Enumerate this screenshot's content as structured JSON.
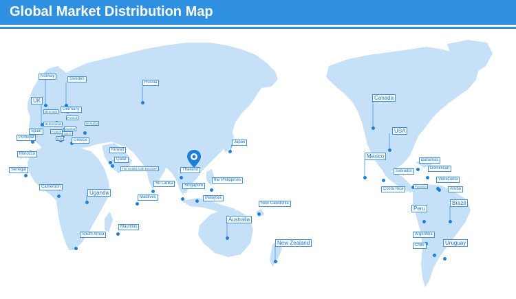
{
  "header": {
    "title": "Global Market Distribution Map"
  },
  "colors": {
    "accent": "#2f8fe0",
    "land": "#c6e0f7",
    "marker": "#1f7fd8",
    "label_border": "#3d93e3",
    "label_text": "#1a6fc0"
  },
  "icons": {
    "hq_marker": "map-pin-icon"
  },
  "locations": [
    {
      "name": "Norway"
    },
    {
      "name": "Sweden"
    },
    {
      "name": "UK"
    },
    {
      "name": "Denmark"
    },
    {
      "name": "Germany"
    },
    {
      "name": "Netherlands"
    },
    {
      "name": "Poland"
    },
    {
      "name": "Hungary"
    },
    {
      "name": "Austria"
    },
    {
      "name": "Spain"
    },
    {
      "name": "France"
    },
    {
      "name": "Swiss"
    },
    {
      "name": "Portugal"
    },
    {
      "name": "Italy"
    },
    {
      "name": "Greece"
    },
    {
      "name": "Morocco"
    },
    {
      "name": "Senegal"
    },
    {
      "name": "Russia"
    },
    {
      "name": "Kuwait"
    },
    {
      "name": "Qatar"
    },
    {
      "name": "The United Arab Emirates"
    },
    {
      "name": "Cameroon"
    },
    {
      "name": "Uganda"
    },
    {
      "name": "Sri Lanka"
    },
    {
      "name": "Maldives"
    },
    {
      "name": "Thailand"
    },
    {
      "name": "Singapore"
    },
    {
      "name": "Malaysia"
    },
    {
      "name": "the Philippines"
    },
    {
      "name": "Japan"
    },
    {
      "name": "Mauritius"
    },
    {
      "name": "South Africa"
    },
    {
      "name": "Australia"
    },
    {
      "name": "New Caledonia"
    },
    {
      "name": "New Zealand"
    },
    {
      "name": "Canada"
    },
    {
      "name": "USA"
    },
    {
      "name": "Mexico"
    },
    {
      "name": "Bahamas"
    },
    {
      "name": "Salvador"
    },
    {
      "name": "Dominican"
    },
    {
      "name": "Venezuela"
    },
    {
      "name": "Costa Rica"
    },
    {
      "name": "Panama"
    },
    {
      "name": "Aruba"
    },
    {
      "name": "Brazil"
    },
    {
      "name": "Peru"
    },
    {
      "name": "Argentina"
    },
    {
      "name": "Chile"
    },
    {
      "name": "Uruguay"
    }
  ]
}
